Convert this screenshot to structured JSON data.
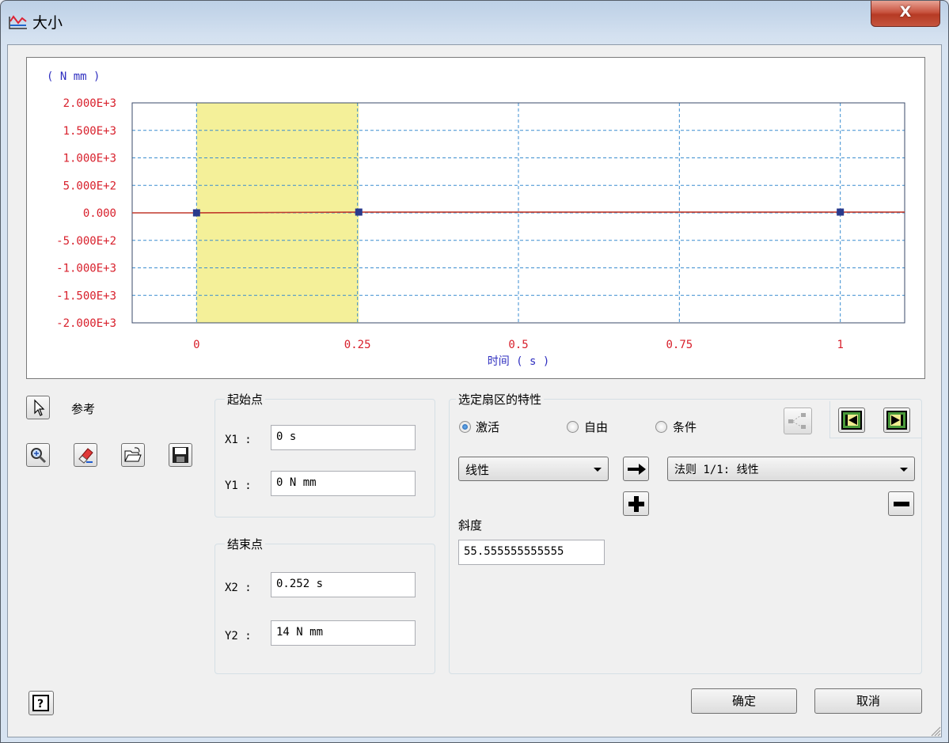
{
  "window": {
    "title": "大小",
    "close_label": "X"
  },
  "chart_data": {
    "type": "line",
    "unit_label": "( N mm )",
    "xlabel": "时间 ( s )",
    "y_ticks": [
      "2.000E+3",
      "1.500E+3",
      "1.000E+3",
      "5.000E+2",
      "0.000",
      "-5.000E+2",
      "-1.000E+3",
      "-1.500E+3",
      "-2.000E+3"
    ],
    "x_ticks": [
      "0",
      "0.25",
      "0.5",
      "0.75",
      "1"
    ],
    "x_tick_values": [
      0,
      0.25,
      0.5,
      0.75,
      1
    ],
    "y_tick_values": [
      2000,
      1500,
      1000,
      500,
      0,
      -500,
      -1000,
      -1500,
      -2000
    ],
    "xlim": [
      -0.1,
      1.1
    ],
    "ylim": [
      -2000,
      2000
    ],
    "grid": true,
    "highlight_range": [
      0,
      0.252
    ],
    "highlight_color": "#f4f099",
    "series": [
      {
        "x": [
          -0.1,
          0,
          0.252,
          1,
          1.1
        ],
        "y": [
          0,
          0,
          14,
          14,
          14
        ],
        "color": "#c0392b"
      }
    ],
    "points": [
      {
        "x": 0,
        "y": 0
      },
      {
        "x": 0.252,
        "y": 14
      },
      {
        "x": 1,
        "y": 14
      }
    ],
    "point_color": "#2a3a8c"
  },
  "left_tools": {
    "reference_label": "参考"
  },
  "start_point": {
    "title": "起始点",
    "x_label": "X1 :",
    "x_value": "0 s",
    "y_label": "Y1 :",
    "y_value": "0 N mm"
  },
  "end_point": {
    "title": "结束点",
    "x_label": "X2 :",
    "x_value": "0.252 s",
    "y_label": "Y2 :",
    "y_value": "14 N mm"
  },
  "sector": {
    "title": "选定扇区的特性",
    "radio_active": "激活",
    "radio_free": "自由",
    "radio_condition": "条件",
    "law_type": "线性",
    "rule": "法则 1/1: 线性",
    "slope_label": "斜度",
    "slope_value": "55.555555555555"
  },
  "buttons": {
    "ok": "确定",
    "cancel": "取消"
  }
}
